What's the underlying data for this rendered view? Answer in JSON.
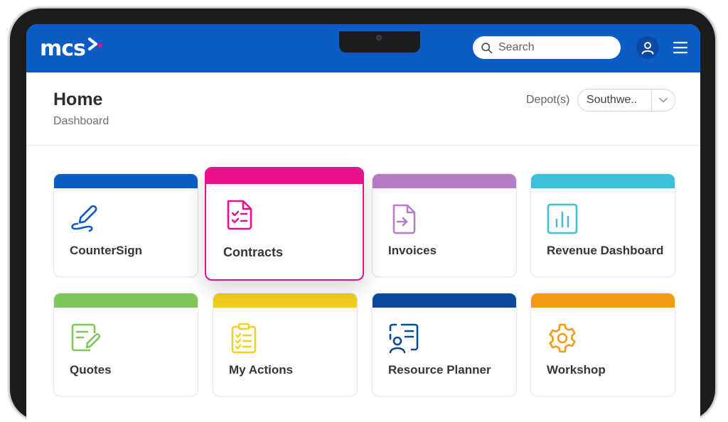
{
  "header": {
    "logo_text": "mcs",
    "search": {
      "placeholder": "Search",
      "value": ""
    },
    "icons": {
      "search": "search-icon",
      "user": "user-icon",
      "menu": "hamburger-menu-icon"
    },
    "brand_color": "#0b5cc4"
  },
  "page": {
    "title": "Home",
    "breadcrumb": "Dashboard",
    "depot_label": "Depot(s)",
    "depot_value": "Southwe.."
  },
  "tiles": [
    {
      "label": "CounterSign",
      "icon": "signature-pen-icon",
      "color": "#0b5cc4",
      "active": false
    },
    {
      "label": "Contracts",
      "icon": "contract-document-icon",
      "color": "#e8108a",
      "active": true
    },
    {
      "label": "Invoices",
      "icon": "invoice-import-icon",
      "color": "#b57cc8",
      "active": false
    },
    {
      "label": "Revenue Dashboard",
      "icon": "bar-chart-icon",
      "color": "#3cc0d8",
      "active": false
    },
    {
      "label": "Quotes",
      "icon": "quote-edit-icon",
      "color": "#7ec85a",
      "active": false
    },
    {
      "label": "My Actions",
      "icon": "clipboard-checklist-icon",
      "color": "#f2cf1c",
      "active": false
    },
    {
      "label": "Resource Planner",
      "icon": "resource-person-icon",
      "color": "#0a4a9a",
      "active": false
    },
    {
      "label": "Workshop",
      "icon": "gear-icon",
      "color": "#f59a12",
      "active": false
    }
  ]
}
